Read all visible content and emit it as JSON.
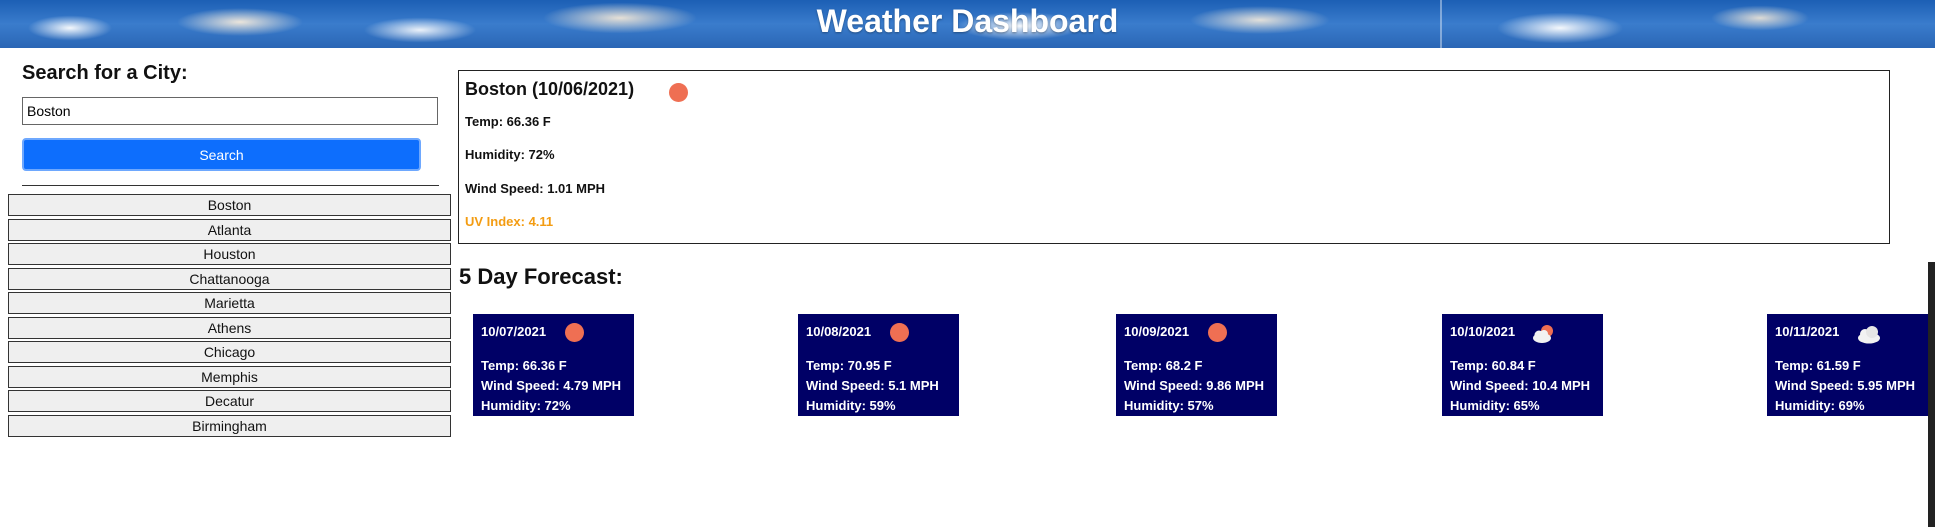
{
  "header": {
    "title": "Weather Dashboard"
  },
  "search": {
    "label": "Search for a City:",
    "value": "Boston",
    "button_label": "Search"
  },
  "history": [
    "Boston",
    "Atlanta",
    "Houston",
    "Chattanooga",
    "Marietta",
    "Athens",
    "Chicago",
    "Memphis",
    "Decatur",
    "Birmingham"
  ],
  "current": {
    "city": "Boston (10/06/2021)",
    "icon": "sun-icon",
    "temp": "Temp: 66.36 F",
    "humidity": "Humidity: 72%",
    "wind": "Wind Speed: 1.01 MPH",
    "uv": "UV Index: 4.11"
  },
  "forecast": {
    "title": "5 Day Forecast:",
    "days": [
      {
        "date": "10/07/2021",
        "icon": "sun-icon",
        "temp": "Temp: 66.36 F",
        "wind": "Wind Speed: 4.79 MPH",
        "humidity": "Humidity: 72%"
      },
      {
        "date": "10/08/2021",
        "icon": "sun-icon",
        "temp": "Temp: 70.95 F",
        "wind": "Wind Speed: 5.1 MPH",
        "humidity": "Humidity: 59%"
      },
      {
        "date": "10/09/2021",
        "icon": "sun-icon",
        "temp": "Temp: 68.2 F",
        "wind": "Wind Speed: 9.86 MPH",
        "humidity": "Humidity: 57%"
      },
      {
        "date": "10/10/2021",
        "icon": "partly-cloudy-icon",
        "temp": "Temp: 60.84 F",
        "wind": "Wind Speed: 10.4 MPH",
        "humidity": "Humidity: 65%"
      },
      {
        "date": "10/11/2021",
        "icon": "cloud-icon",
        "temp": "Temp: 61.59 F",
        "wind": "Wind Speed: 5.95 MPH",
        "humidity": "Humidity: 69%"
      }
    ]
  },
  "colors": {
    "primary_button": "#0d6efd",
    "card_background": "#000066",
    "uv_text": "#f39c12",
    "sun": "#ef6f53"
  }
}
